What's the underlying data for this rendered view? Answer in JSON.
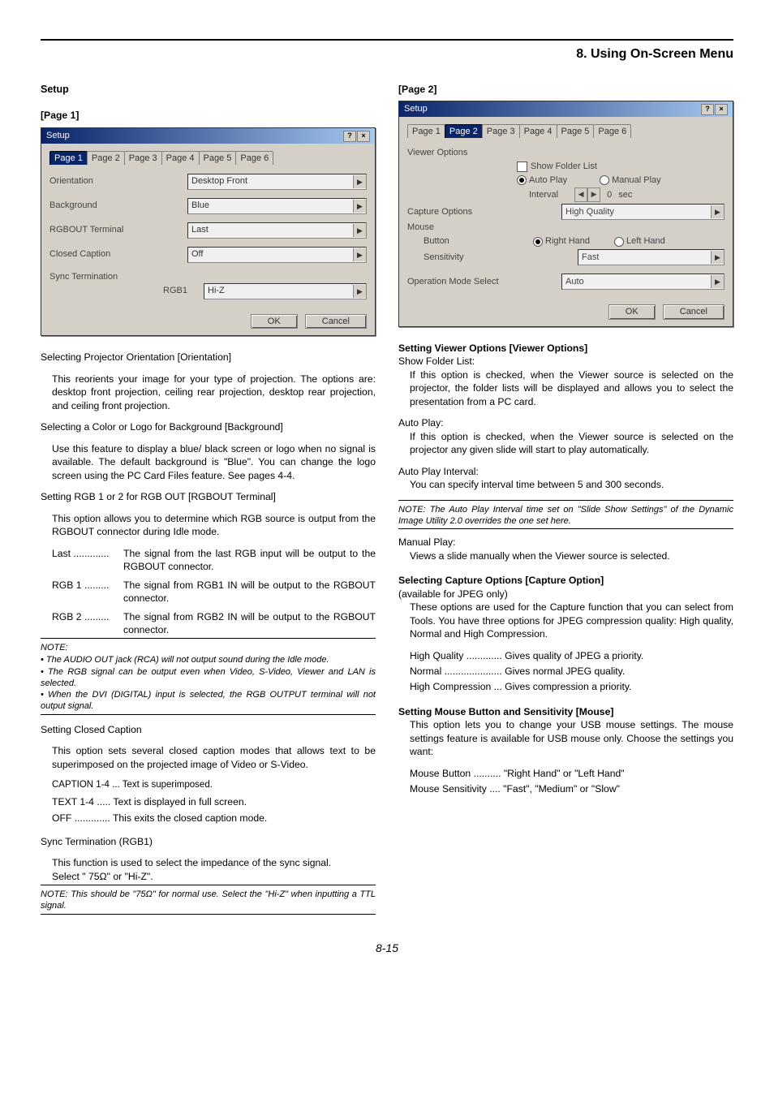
{
  "chapter": "8. Using On-Screen Menu",
  "page_number": "8-15",
  "left": {
    "h_setup": "Setup",
    "h_page": "[Page 1]",
    "dlg": {
      "title": "Setup",
      "tabs": [
        "Page 1",
        "Page 2",
        "Page 3",
        "Page 4",
        "Page 5",
        "Page 6"
      ],
      "sel_tab": "Page 1",
      "rows": {
        "orientation_label": "Orientation",
        "orientation_val": "Desktop Front",
        "background_label": "Background",
        "background_val": "Blue",
        "rgbout_label": "RGBOUT Terminal",
        "rgbout_val": "Last",
        "cc_label": "Closed Caption",
        "cc_val": "Off",
        "sync_label1": "Sync Termination",
        "sync_label2": "RGB1",
        "sync_val": "Hi-Z"
      },
      "ok": "OK",
      "cancel": "Cancel"
    },
    "s1_h": "Selecting Projector Orientation [Orientation]",
    "s1_p": "This reorients your image for your type of projection. The options are: desktop front projection, ceiling rear projection, desktop rear projection, and ceiling front projection.",
    "s2_h": "Selecting a Color or Logo for Background [Background]",
    "s2_p": "Use this feature to display a blue/ black screen or logo when no signal is available. The default background is \"Blue\". You can change the logo screen using the PC Card Files feature. See pages 4-4.",
    "s3_h": "Setting RGB 1 or 2 for RGB OUT [RGBOUT Terminal]",
    "s3_p": "This option allows you to determine which RGB source is output from the RGBOUT connector during Idle mode.",
    "s3_last_l": "Last .............",
    "s3_last_v": "The signal from the last RGB input will be output to the RGBOUT connector.",
    "s3_rgb1_l": "RGB 1 .........",
    "s3_rgb1_v": "The signal from RGB1 IN will be output to the RGBOUT connector.",
    "s3_rgb2_l": "RGB 2 .........",
    "s3_rgb2_v": "The signal from RGB2 IN will be output to the RGBOUT connector.",
    "note1_h": "NOTE:",
    "note1_b1": "• The AUDIO OUT jack (RCA) will not output sound during the Idle mode.",
    "note1_b2": "• The RGB signal can be output even when Video, S-Video, Viewer and LAN is selected.",
    "note1_b3": "• When the DVI (DIGITAL) input is selected, the RGB OUTPUT terminal will not output signal.",
    "s4_h": "Setting Closed Caption",
    "s4_p": "This option sets several closed caption modes that allows text to be superimposed on the projected image of Video or S-Video.",
    "s4_cap": "CAPTION 1-4 ... Text is superimposed.",
    "s4_txt": "TEXT 1-4 ..... Text is displayed in full screen.",
    "s4_off": "OFF ............. This exits the closed caption mode.",
    "s5_h": "Sync Termination (RGB1)",
    "s5_p": "This function is used to select the impedance of the sync signal.",
    "s5_sel": "Select \" 75Ω\" or \"Hi-Z\".",
    "note2": "NOTE: This should be \"75Ω\" for normal use. Select the \"Hi-Z\" when inputting a TTL signal."
  },
  "right": {
    "h_page": "[Page 2]",
    "dlg": {
      "title": "Setup",
      "tabs": [
        "Page 1",
        "Page 2",
        "Page 3",
        "Page 4",
        "Page 5",
        "Page 6"
      ],
      "sel_tab": "Page 2",
      "viewer_label": "Viewer Options",
      "show_folder": "Show Folder List",
      "auto_play": "Auto Play",
      "manual_play": "Manual Play",
      "interval_label": "Interval",
      "interval_val": "0",
      "interval_unit": "sec",
      "capture_label": "Capture Options",
      "capture_val": "High Quality",
      "mouse_label": "Mouse",
      "button_label": "Button",
      "right_hand": "Right Hand",
      "left_hand": "Left Hand",
      "sens_label": "Sensitivity",
      "sens_val": "Fast",
      "opmode_label": "Operation Mode Select",
      "opmode_val": "Auto",
      "ok": "OK",
      "cancel": "Cancel"
    },
    "sv_h": "Setting Viewer Options [Viewer Options]",
    "sfl_h": "Show Folder List:",
    "sfl_p": "If this option is checked, when the Viewer source is selected on the projector, the folder lists will be displayed and allows you to select the presentation from a PC card.",
    "ap_h": "Auto Play:",
    "ap_p": "If this option is checked, when the Viewer source is selected on the projector any given slide will start to play automatically.",
    "api_h": "Auto Play Interval:",
    "api_p": "You can specify interval time between 5 and 300 seconds.",
    "api_note": "NOTE: The Auto Play Interval time set on \"Slide Show Settings\" of the Dynamic Image Utility 2.0 overrides the one set here.",
    "mp_h": "Manual Play:",
    "mp_p": "Views a slide manually when the Viewer source is selected.",
    "co_h": "Selecting Capture Options [Capture Option]",
    "co_av": "(available for JPEG only)",
    "co_p": "These options are used for the Capture function that you can select from Tools. You have three options for JPEG compression quality: High quality, Normal and High Compression.",
    "co_hq": "High Quality ............. Gives quality of JPEG a priority.",
    "co_n": "Normal ..................... Gives normal JPEG quality.",
    "co_hc": "High Compression ... Gives compression a priority.",
    "ms_h": "Setting Mouse Button and Sensitivity [Mouse]",
    "ms_p": "This option lets you to change your USB mouse settings. The mouse settings feature is available for USB mouse only. Choose the settings you want:",
    "ms_b": "Mouse Button .......... \"Right Hand\" or \"Left Hand\"",
    "ms_s": "Mouse Sensitivity .... \"Fast\", \"Medium\" or \"Slow\""
  }
}
